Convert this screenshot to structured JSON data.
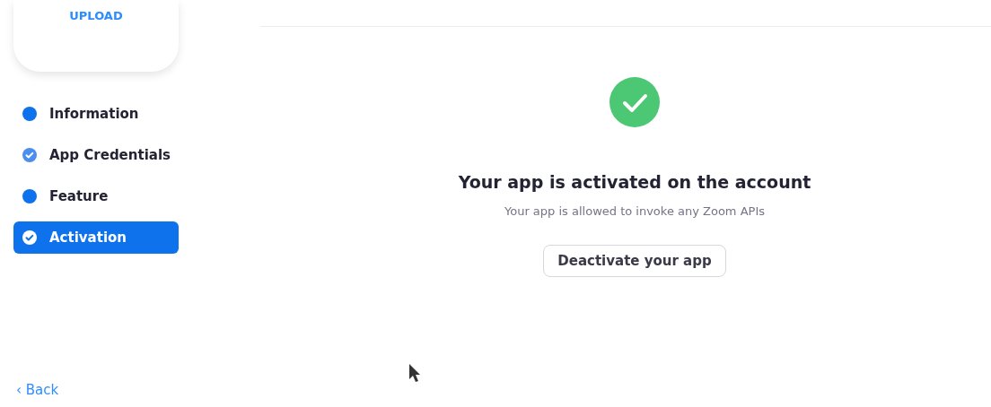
{
  "upload": {
    "label": "UPLOAD"
  },
  "steps": [
    {
      "label": "Information",
      "kind": "dot",
      "selected": false
    },
    {
      "label": "App Credentials",
      "kind": "check",
      "selected": false
    },
    {
      "label": "Feature",
      "kind": "dot",
      "selected": false
    },
    {
      "label": "Activation",
      "kind": "check",
      "selected": true
    }
  ],
  "back": {
    "arrow": "‹",
    "label": "Back"
  },
  "status": {
    "title": "Your app is activated on the account",
    "subtitle": "Your app is allowed to invoke any Zoom APIs",
    "button": "Deactivate your app"
  }
}
